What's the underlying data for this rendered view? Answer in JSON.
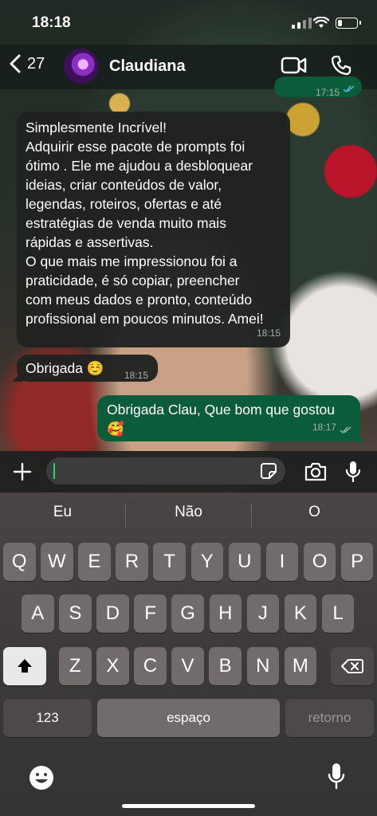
{
  "status_bar": {
    "time": "18:18",
    "battery_level": 0.25
  },
  "header": {
    "back_count": "27",
    "contact_name": "Claudiana",
    "icons": {
      "back": "chevron-left-icon",
      "video": "video-camera-icon",
      "call": "phone-icon"
    }
  },
  "messages": [
    {
      "direction": "out",
      "text": "",
      "time": "17:15",
      "status": "read"
    },
    {
      "direction": "in",
      "lines": [
        "Simplesmente Incrível!",
        "Adquirir esse pacote de prompts foi",
        "ótimo . Ele me ajudou a desbloquear",
        "ideias, criar conteúdos de valor,",
        "legendas, roteiros, ofertas e até",
        "estratégias de venda muito mais",
        "rápidas e assertivas.",
        "O que mais me impressionou foi a",
        "praticidade, é só copiar, preencher",
        "com meus dados e pronto, conteúdo",
        "profissional em poucos minutos. Amei!"
      ],
      "time": "18:15"
    },
    {
      "direction": "in",
      "text": "Obrigada ☺️",
      "time": "18:15"
    },
    {
      "direction": "out",
      "lines": [
        "Obrigada Clau, Que bom que gostou",
        "🥰"
      ],
      "time": "18:17",
      "status": "delivered"
    }
  ],
  "input": {
    "placeholder": "",
    "icons": [
      "plus-icon",
      "sticker-icon",
      "camera-icon",
      "microphone-icon"
    ]
  },
  "keyboard": {
    "suggestions": [
      "Eu",
      "Não",
      "O"
    ],
    "row1": [
      "Q",
      "W",
      "E",
      "R",
      "T",
      "Y",
      "U",
      "I",
      "O",
      "P"
    ],
    "row2": [
      "A",
      "S",
      "D",
      "F",
      "G",
      "H",
      "J",
      "K",
      "L"
    ],
    "row3": [
      "Z",
      "X",
      "C",
      "V",
      "B",
      "N",
      "M"
    ],
    "numbers_key": "123",
    "space_key": "espaço",
    "return_key": "retorno"
  },
  "colors": {
    "outgoing_bubble": "#0b5c3b",
    "incoming_bubble": "#202221",
    "accent": "#25d366"
  }
}
